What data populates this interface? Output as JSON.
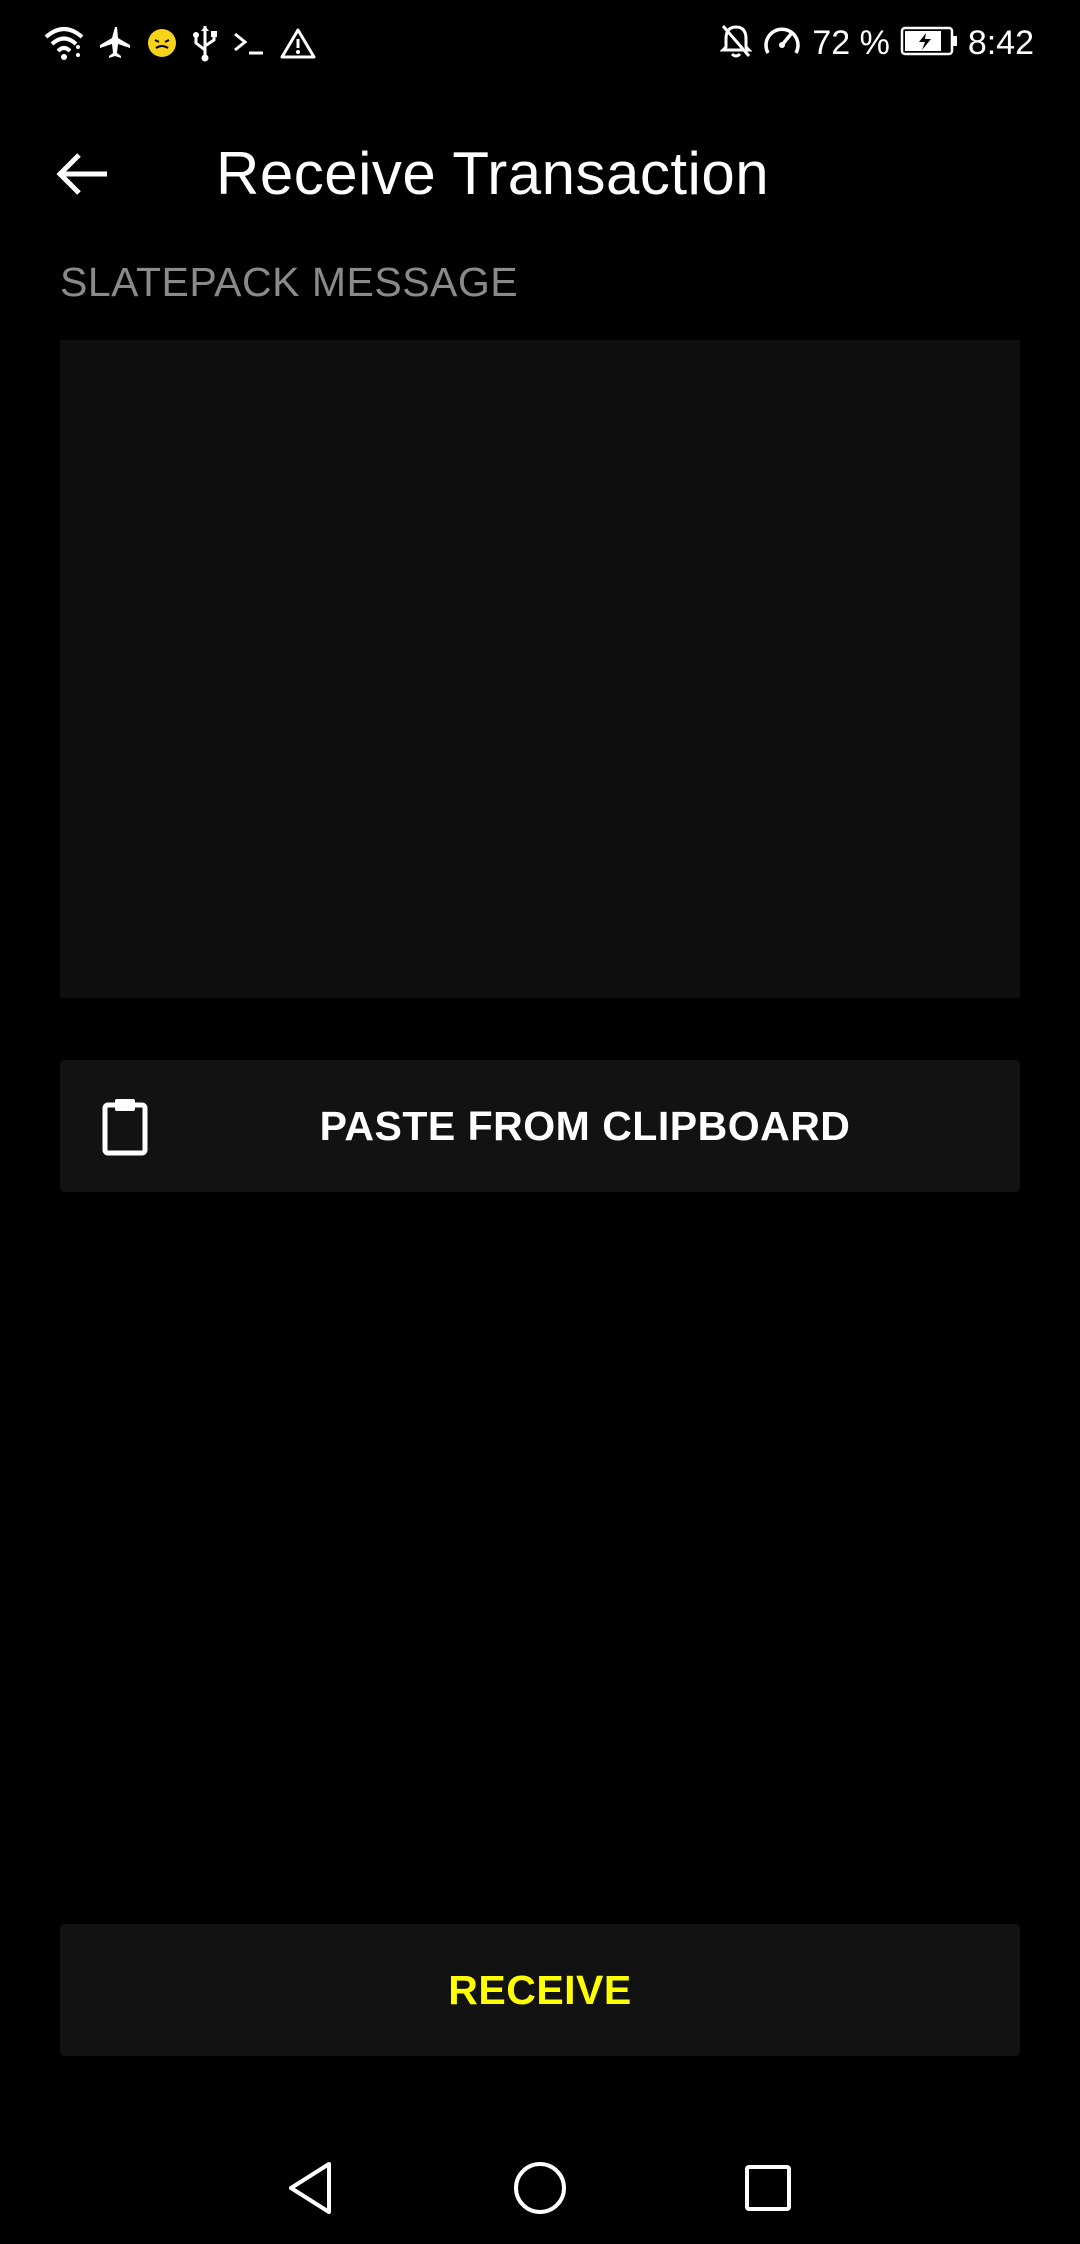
{
  "status_bar": {
    "battery_percent": "72 %",
    "time": "8:42",
    "left_icons": [
      "wifi-icon",
      "airplane-icon",
      "emoji-icon",
      "usb-icon",
      "terminal-icon",
      "warning-icon"
    ],
    "right_icons": [
      "notifications-off-icon",
      "speedometer-icon",
      "battery-charging-icon"
    ]
  },
  "app_bar": {
    "title": "Receive Transaction",
    "back_icon": "arrow-back-icon"
  },
  "form": {
    "slatepack_label": "SLATEPACK MESSAGE",
    "slatepack_value": "",
    "paste_label": "PASTE FROM CLIPBOARD",
    "paste_icon": "clipboard-icon",
    "receive_label": "RECEIVE"
  },
  "nav_bar": {
    "buttons": [
      "back-triangle-icon",
      "home-circle-icon",
      "recents-square-icon"
    ]
  },
  "colors": {
    "background": "#000000",
    "surface": "#121212",
    "input_surface": "#0f0f0f",
    "label_gray": "#8a8a8a",
    "accent_yellow": "#ffff00",
    "text": "#ffffff"
  }
}
